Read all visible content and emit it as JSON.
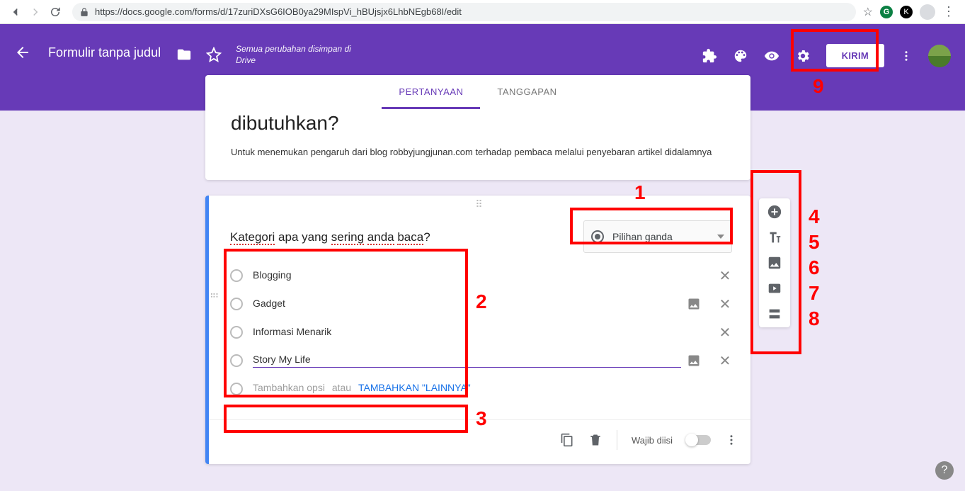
{
  "browser": {
    "url": "https://docs.google.com/forms/d/17zuriDXsG6IOB0ya29MIspVi_hBUjsjx6LhbNEgb68I/edit",
    "ext_g": "G",
    "ext_k": "K"
  },
  "header": {
    "title": "Formulir tanpa judul",
    "save_status": "Semua perubahan disimpan di Drive",
    "send_label": "KIRIM"
  },
  "tabs": {
    "questions": "PERTANYAAN",
    "responses": "TANGGAPAN"
  },
  "form": {
    "title": "dibutuhkan?",
    "description": "Untuk menemukan pengaruh dari blog robbyjungjunan.com terhadap pembaca melalui penyebaran artikel didalamnya"
  },
  "question": {
    "text_parts": [
      "Kategori",
      " apa yang ",
      "sering",
      " ",
      "anda",
      " ",
      "baca",
      "?"
    ],
    "type_label": "Pilihan ganda",
    "options": [
      {
        "label": "Blogging",
        "has_image_btn": false
      },
      {
        "label": "Gadget",
        "has_image_btn": true
      },
      {
        "label": "Informasi Menarik",
        "has_image_btn": false
      },
      {
        "label": "Story My Life",
        "has_image_btn": true,
        "underline": true
      }
    ],
    "add_option_placeholder": "Tambahkan opsi",
    "add_or": "atau",
    "add_other": "TAMBAHKAN \"LAINNYA\""
  },
  "footer": {
    "required_label": "Wajib diisi"
  },
  "annotations": {
    "n1": "1",
    "n2": "2",
    "n3": "3",
    "n4": "4",
    "n5": "5",
    "n6": "6",
    "n7": "7",
    "n8": "8",
    "n9": "9"
  },
  "chart_data": null
}
